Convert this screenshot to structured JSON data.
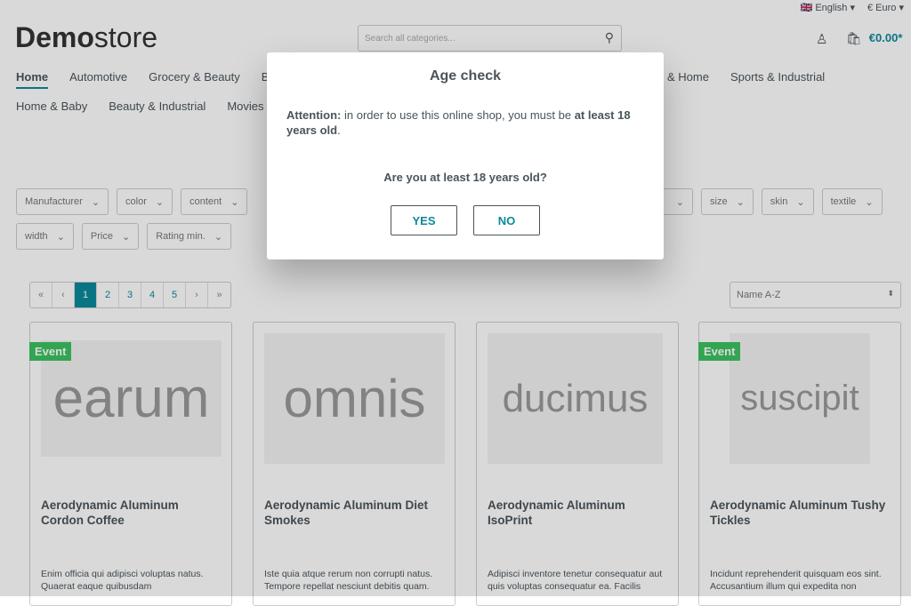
{
  "topbar": {
    "language": "English",
    "currency": "€ Euro"
  },
  "header": {
    "logo_bold": "Demo",
    "logo_light": "store",
    "search_placeholder": "Search all categories...",
    "cart_total": "€0.00*"
  },
  "nav": {
    "row1": [
      "Home",
      "Automotive",
      "Grocery & Beauty",
      "Be",
      "& Home",
      "Sports & Industrial"
    ],
    "row2": [
      "Home & Baby",
      "Beauty & Industrial",
      "Movies &"
    ]
  },
  "filters": {
    "row1_left": [
      "Manufacturer",
      "color",
      "content"
    ],
    "row1_right": [
      "",
      "size",
      "skin",
      "textile"
    ],
    "row2": [
      "width",
      "Price",
      "Rating min."
    ]
  },
  "pagination": {
    "pages": [
      "«",
      "‹",
      "1",
      "2",
      "3",
      "4",
      "5",
      "›",
      "»"
    ],
    "current": "1"
  },
  "sort": {
    "selected": "Name A-Z"
  },
  "products": [
    {
      "image_text": "earum",
      "badge": "Event",
      "name": "Aerodynamic Aluminum Cordon Coffee",
      "desc": "Enim officia qui adipisci voluptas natus. Quaerat eaque quibusdam"
    },
    {
      "image_text": "omnis",
      "badge": "",
      "name": "Aerodynamic Aluminum Diet Smokes",
      "desc": "Iste quia atque rerum non corrupti natus. Tempore repellat nesciunt debitis quam."
    },
    {
      "image_text": "ducimus",
      "badge": "",
      "name": "Aerodynamic Aluminum IsoPrint",
      "desc": "Adipisci inventore tenetur consequatur aut quis voluptas consequatur ea. Facilis"
    },
    {
      "image_text": "suscipit",
      "badge": "Event",
      "name": "Aerodynamic Aluminum Tushy Tickles",
      "desc": "Incidunt reprehenderit quisquam eos sint. Accusantium illum qui expedita non"
    }
  ],
  "modal": {
    "title": "Age check",
    "attention": "Attention:",
    "msg1": " in order to use this online shop, you must be ",
    "msg_bold": "at least 18 years old",
    "msg2": ".",
    "question": "Are you at least 18 years old?",
    "yes": "YES",
    "no": "NO"
  },
  "colors": {
    "accent": "#0b8a9a",
    "badge": "#3cc261"
  }
}
